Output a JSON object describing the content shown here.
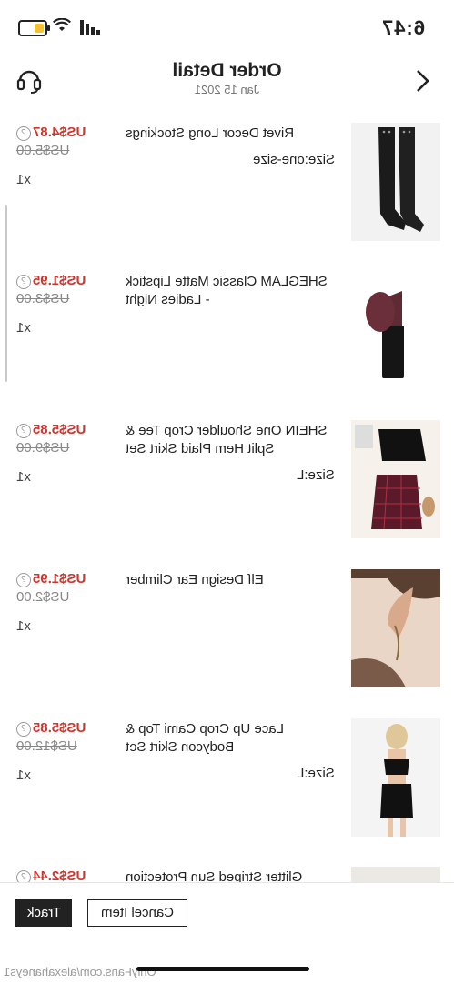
{
  "status_bar": {
    "time": "6:47",
    "battery_level": 0.35
  },
  "header": {
    "title": "Order Detail",
    "date": "Jan 15 2021"
  },
  "items": [
    {
      "name": "Rivet Decor Long Stockings",
      "size": "Size:one-size",
      "price": "US$4.87",
      "original_price": "US$5.00",
      "qty": "x1"
    },
    {
      "name": "SHEGLAM Classic Matte Lipstick - Ladies Night",
      "size": "",
      "price": "US$1.95",
      "original_price": "US$3.00",
      "qty": "x1"
    },
    {
      "name": "SHEIN One Shoulder Crop Tee & Split Hem Plaid Skirt Set",
      "size": "Size:L",
      "price": "US$5.85",
      "original_price": "US$9.00",
      "qty": "x1"
    },
    {
      "name": "Elf Design Ear Climber",
      "size": "",
      "price": "US$1.95",
      "original_price": "US$2.00",
      "qty": "x1"
    },
    {
      "name": "Lace Up Crop Cami Top & Bodycon Skirt Set",
      "size": "Size:L",
      "price": "US$5.85",
      "original_price": "US$12.00",
      "qty": "x1"
    },
    {
      "name": "Glitter Striped Sun Protection",
      "size": "",
      "price": "US$2.44",
      "original_price": "",
      "qty": ""
    }
  ],
  "help_glyph": "?",
  "actions": {
    "track_label": "Track",
    "cancel_label": "Cancel Item"
  },
  "watermark": "OnlyFans.com/alexahaneys1",
  "icons": {
    "back": "chevron-right-icon",
    "support": "headset-icon"
  }
}
